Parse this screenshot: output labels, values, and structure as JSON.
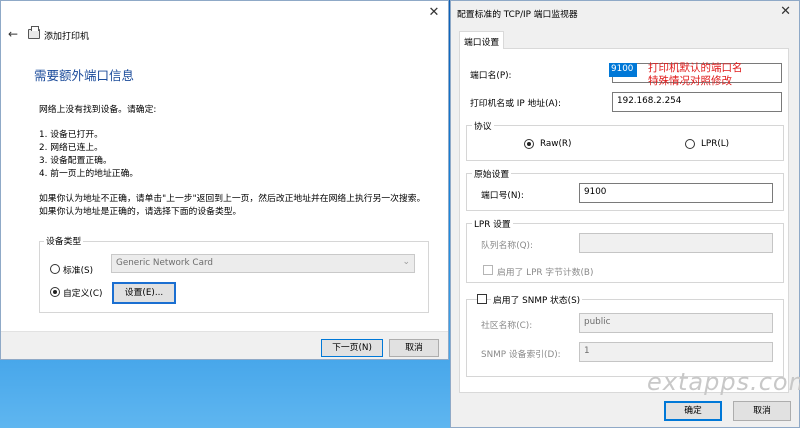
{
  "wizard": {
    "title": "添加打印机",
    "heading": "需要额外端口信息",
    "intro": "网络上没有找到设备。请确定:",
    "checklist": [
      "1.  设备已打开。",
      "2.  网络已连上。",
      "3.  设备配置正确。",
      "4.  前一页上的地址正确。"
    ],
    "note_line1": "如果你认为地址不正确，请单击\"上一步\"返回到上一页，然后改正地址并在网络上执行另一次搜索。",
    "note_line2": "如果你认为地址是正确的，请选择下面的设备类型。",
    "device_type": {
      "legend": "设备类型",
      "standard_label": "标准(S)",
      "standard_value": "Generic Network Card",
      "custom_label": "自定义(C)",
      "selected": "custom",
      "settings_button": "设置(E)..."
    },
    "next_button": "下一页(N)",
    "cancel_button": "取消"
  },
  "dialog": {
    "title": "配置标准的 TCP/IP 端口监视器",
    "tab_label": "端口设置",
    "port_name_label": "端口名(P):",
    "port_name_value": "9100",
    "printer_address_label": "打印机名或 IP 地址(A):",
    "printer_address_value": "192.168.2.254",
    "protocol": {
      "legend": "协议",
      "raw_label": "Raw(R)",
      "lpr_label": "LPR(L)",
      "selected": "raw"
    },
    "raw_settings": {
      "legend": "原始设置",
      "port_number_label": "端口号(N):",
      "port_number_value": "9100"
    },
    "lpr_settings": {
      "legend": "LPR 设置",
      "queue_label": "队列名称(Q):",
      "queue_value": "",
      "byte_count_label": "启用了 LPR 字节计数(B)"
    },
    "snmp": {
      "legend": "启用了 SNMP 状态(S)",
      "community_label": "社区名称(C):",
      "community_value": "public",
      "index_label": "SNMP 设备索引(D):",
      "index_value": "1"
    },
    "ok_button": "确定",
    "cancel_button": "取消"
  },
  "annotation": {
    "line1": "打印机默认的端口名",
    "line2": "特殊情况对照修改"
  },
  "watermark": "extapps.com"
}
